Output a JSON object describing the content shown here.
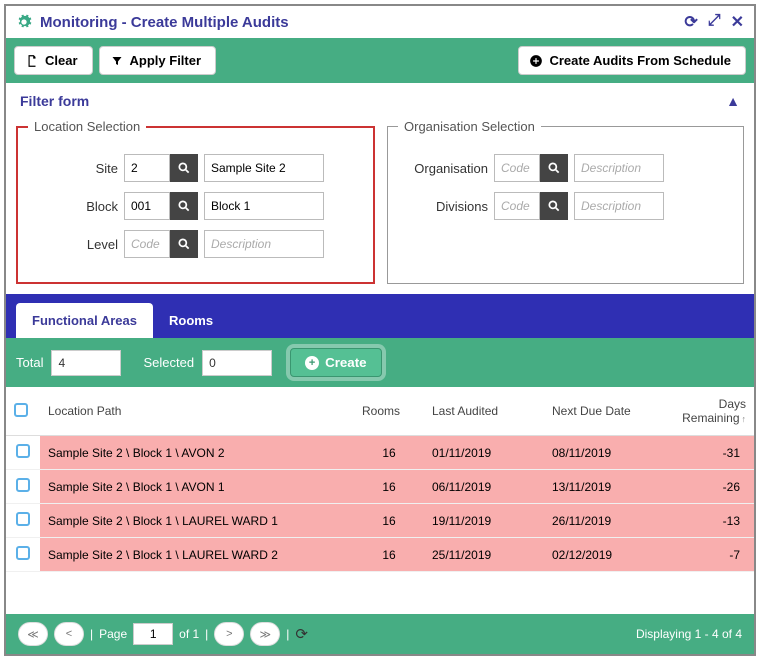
{
  "title": "Monitoring - Create Multiple Audits",
  "toolbar": {
    "clear": "Clear",
    "apply": "Apply Filter",
    "schedule": "Create Audits From Schedule"
  },
  "filter": {
    "title": "Filter form"
  },
  "loc": {
    "legend": "Location Selection",
    "site_label": "Site",
    "site_code": "2",
    "site_desc": "Sample Site 2",
    "block_label": "Block",
    "block_code": "001",
    "block_desc": "Block 1",
    "level_label": "Level",
    "level_code_ph": "Code",
    "level_desc_ph": "Description"
  },
  "org": {
    "legend": "Organisation Selection",
    "org_label": "Organisation",
    "org_code_ph": "Code",
    "org_desc_ph": "Description",
    "div_label": "Divisions",
    "div_code_ph": "Code",
    "div_desc_ph": "Description"
  },
  "tabs": {
    "fa": "Functional Areas",
    "rooms": "Rooms"
  },
  "counts": {
    "total_label": "Total",
    "total": "4",
    "selected_label": "Selected",
    "selected": "0",
    "create": "Create"
  },
  "cols": {
    "path": "Location Path",
    "rooms": "Rooms",
    "last": "Last Audited",
    "next": "Next Due Date",
    "days": "Days Remaining"
  },
  "rows": [
    {
      "path": "Sample Site 2 \\ Block 1 \\ AVON 2",
      "rooms": "16",
      "last": "01/11/2019",
      "next": "08/11/2019",
      "days": "-31"
    },
    {
      "path": "Sample Site 2 \\ Block 1 \\ AVON 1",
      "rooms": "16",
      "last": "06/11/2019",
      "next": "13/11/2019",
      "days": "-26"
    },
    {
      "path": "Sample Site 2 \\ Block 1 \\ LAUREL WARD 1",
      "rooms": "16",
      "last": "19/11/2019",
      "next": "26/11/2019",
      "days": "-13"
    },
    {
      "path": "Sample Site 2 \\ Block 1 \\ LAUREL WARD 2",
      "rooms": "16",
      "last": "25/11/2019",
      "next": "02/12/2019",
      "days": "-7"
    }
  ],
  "pager": {
    "page_label": "Page",
    "page": "1",
    "of": "of 1",
    "disp": "Displaying 1 - 4 of 4"
  }
}
